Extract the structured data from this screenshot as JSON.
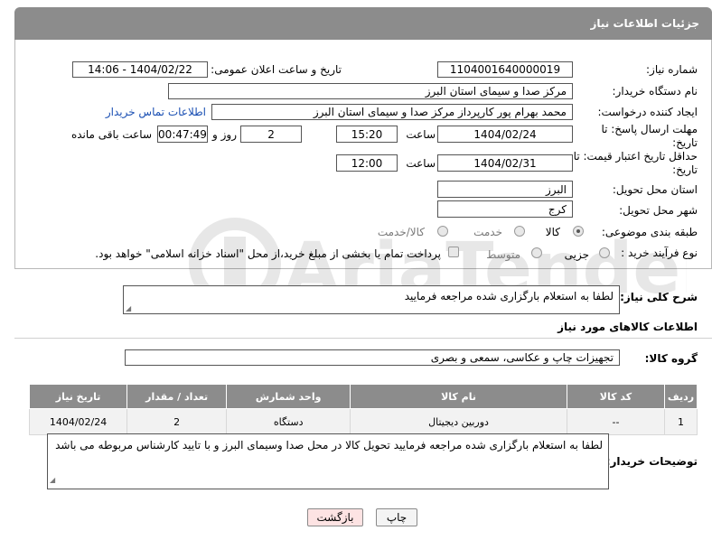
{
  "header": {
    "title": "جزئیات اطلاعات نیاز"
  },
  "form": {
    "need_number_label": "شماره نیاز:",
    "need_number": "1104001640000019",
    "announce_label": "تاریخ و ساعت اعلان عمومی:",
    "announce_value": "1404/02/22 - 14:06",
    "buyer_org_label": "نام دستگاه خریدار:",
    "buyer_org": "مرکز صدا و سیمای استان البرز",
    "creator_label": "ایجاد کننده درخواست:",
    "creator": "محمد بهرام پور کارپرداز مرکز صدا و سیمای استان البرز",
    "contact_link": "اطلاعات تماس خریدار",
    "reply_deadline_label": "مهلت ارسال پاسخ: تا تاریخ:",
    "reply_date": "1404/02/24",
    "time_label": "ساعت",
    "reply_time": "15:20",
    "days_value": "2",
    "days_label": "روز و",
    "remaining_time": "00:47:49",
    "remaining_label": "ساعت باقی مانده",
    "price_validity_label": "حداقل تاریخ اعتبار قیمت: تا تاریخ:",
    "price_date": "1404/02/31",
    "price_time": "12:00",
    "province_label": "استان محل تحویل:",
    "province": "البرز",
    "city_label": "شهر محل تحویل:",
    "city": "کرج",
    "category_label": "طبقه بندی موضوعی:",
    "category_options": [
      "کالا",
      "خدمت",
      "کالا/خدمت"
    ],
    "category_selected": "کالا",
    "process_label": "نوع فرآیند خرید :",
    "process_options": [
      "جزیی",
      "متوسط"
    ],
    "payment_note": "پرداخت تمام یا بخشی از مبلغ خرید،از محل \"اسناد خزانه اسلامی\" خواهد بود."
  },
  "description": {
    "label": "شرح کلی نیاز:",
    "text": "لطفا به استعلام بارگزاری شده مراجعه فرمایید"
  },
  "goods": {
    "section_title": "اطلاعات کالاهای مورد نیاز",
    "group_label": "گروه کالا:",
    "group_value": "تجهیزات چاپ و عکاسی، سمعی و بصری",
    "columns": [
      "ردیف",
      "کد کالا",
      "نام کالا",
      "واحد شمارش",
      "تعداد / مقدار",
      "تاریخ نیاز"
    ],
    "rows": [
      {
        "row": "1",
        "code": "--",
        "name": "دوربین دیجیتال",
        "unit": "دستگاه",
        "qty": "2",
        "date": "1404/02/24"
      }
    ]
  },
  "buyer_notes": {
    "label": "توضیحات خریدار:",
    "text": "لطفا به استعلام بارگزاری شده مراجعه فرمایید تحویل کالا در محل صدا وسیمای البرز و با تایید کارشناس مربوطه می باشد"
  },
  "buttons": {
    "print": "چاپ",
    "back": "بازگشت"
  },
  "watermark": {
    "text": "AriaTender.neT"
  }
}
